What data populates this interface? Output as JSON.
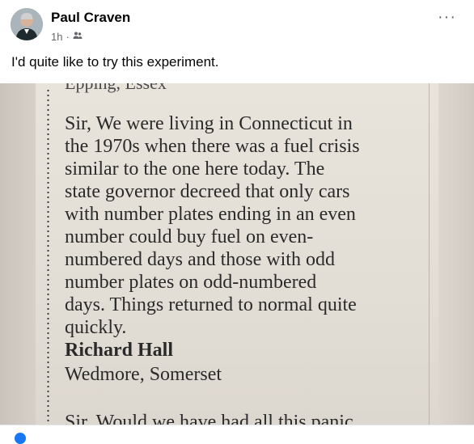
{
  "post": {
    "author": "Paul Craven",
    "time": "1h",
    "separator": "·",
    "caption": "I'd quite like to try this experiment.",
    "more_label": "···"
  },
  "photo": {
    "cut_top_text": "Epping, Essex",
    "letter_lines": [
      "Sir, We were living in Connecticut in",
      "the 1970s when there was a fuel crisis",
      "similar to the one here today. The",
      "state governor decreed that only cars",
      "with number plates ending in an even",
      "number could buy fuel on even-",
      "numbered days and those with odd",
      "number plates on odd-numbered",
      "days. Things returned to normal quite",
      "quickly."
    ],
    "signature": "Richard Hall",
    "location": "Wedmore, Somerset",
    "next_letter": "Sir, Would we have had all this panic"
  },
  "icons": {
    "audience": "friends-icon",
    "more": "more-options-icon"
  },
  "colors": {
    "name": "#050505",
    "meta": "#65676b",
    "link": "#1877f2"
  }
}
